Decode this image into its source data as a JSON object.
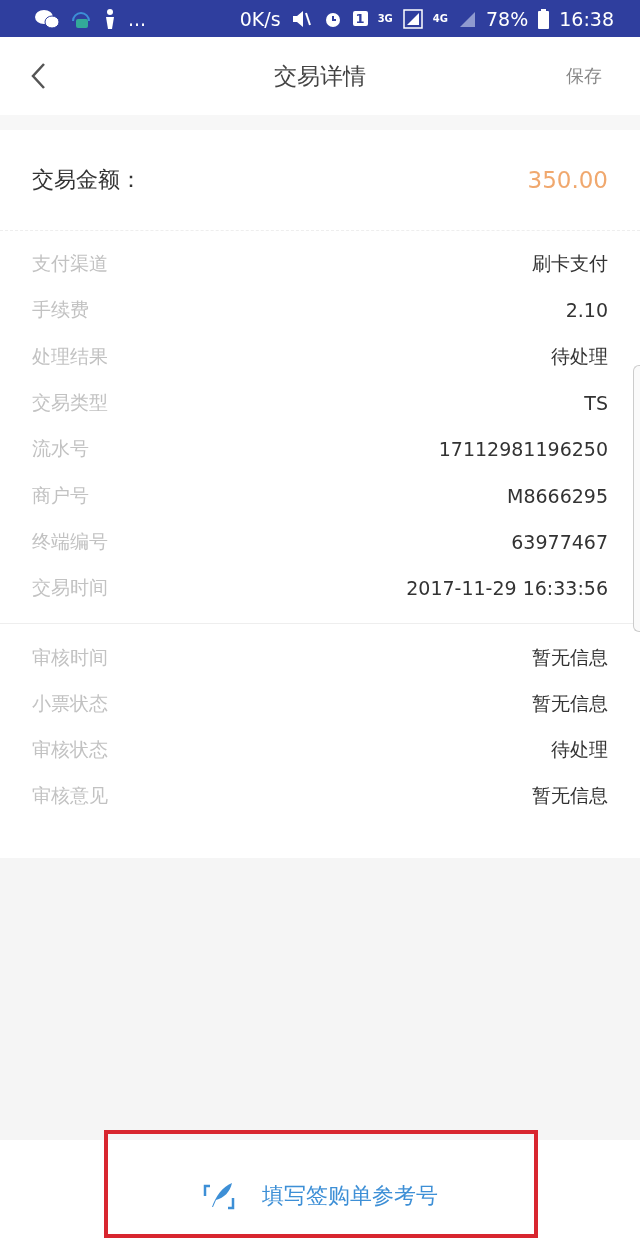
{
  "status_bar": {
    "more": "...",
    "speed": "0K/s",
    "sim": "1",
    "net1": "3G",
    "net2": "4G",
    "battery": "78%",
    "time": "16:38"
  },
  "header": {
    "title": "交易详情",
    "action": "保存"
  },
  "amount": {
    "label": "交易金额：",
    "value": "350.00"
  },
  "groups": [
    [
      {
        "label": "支付渠道",
        "value": "刷卡支付"
      },
      {
        "label": "手续费",
        "value": "2.10"
      },
      {
        "label": "处理结果",
        "value": "待处理"
      },
      {
        "label": "交易类型",
        "value": "TS"
      },
      {
        "label": "流水号",
        "value": "17112981196250"
      },
      {
        "label": "商户号",
        "value": "M8666295"
      },
      {
        "label": "终端编号",
        "value": "63977467"
      },
      {
        "label": "交易时间",
        "value": "2017-11-29 16:33:56"
      }
    ],
    [
      {
        "label": "审核时间",
        "value": "暂无信息"
      },
      {
        "label": "小票状态",
        "value": "暂无信息"
      },
      {
        "label": "审核状态",
        "value": "待处理"
      },
      {
        "label": "审核意见",
        "value": "暂无信息"
      }
    ]
  ],
  "bottom_button": {
    "label": "填写签购单参考号"
  }
}
